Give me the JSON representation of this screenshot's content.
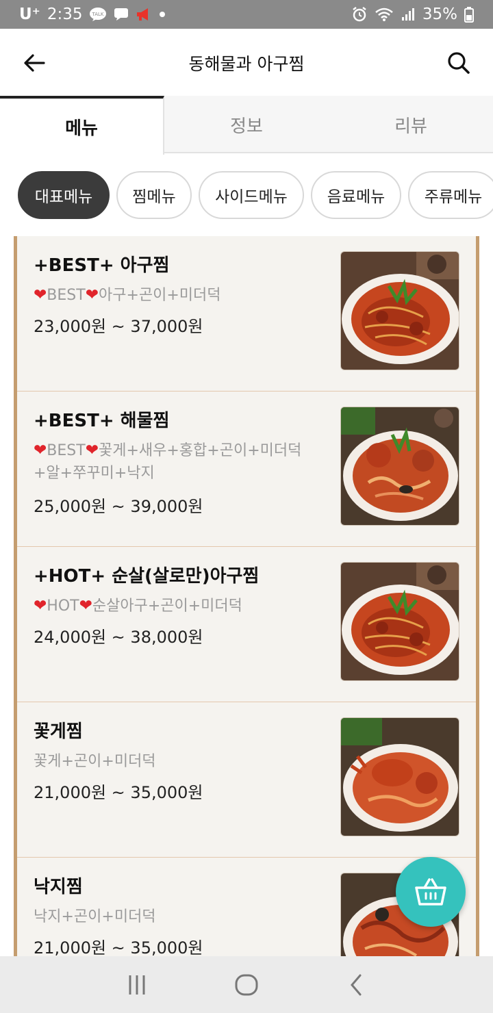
{
  "status_bar": {
    "carrier": "U⁺",
    "time": "2:35",
    "battery": "35%",
    "talk_badge": "TALK"
  },
  "header": {
    "title": "동해물과 아구찜"
  },
  "tabs": [
    {
      "label": "메뉴",
      "active": true
    },
    {
      "label": "정보",
      "active": false
    },
    {
      "label": "리뷰",
      "active": false
    }
  ],
  "categories": [
    {
      "label": "대표메뉴",
      "active": true
    },
    {
      "label": "찜메뉴",
      "active": false
    },
    {
      "label": "사이드메뉴",
      "active": false
    },
    {
      "label": "음료메뉴",
      "active": false
    },
    {
      "label": "주류메뉴",
      "active": false
    }
  ],
  "menu_items": [
    {
      "name": "+BEST+ 아구찜",
      "badge": "BEST",
      "desc": "아구+곤이+미더덕",
      "desc_line2": "",
      "price": "23,000원 ~ 37,000원"
    },
    {
      "name": "+BEST+ 해물찜",
      "badge": "BEST",
      "desc": "꽃게+새우+홍합+곤이+미더덕",
      "desc_line2": "+알+쭈꾸미+낙지",
      "price": "25,000원 ~ 39,000원"
    },
    {
      "name": "+HOT+ 순살(살로만)아구찜",
      "badge": "HOT",
      "desc": "순살아구+곤이+미더덕",
      "desc_line2": "",
      "price": "24,000원 ~ 38,000원"
    },
    {
      "name": "꽃게찜",
      "badge": "",
      "desc": "꽃게+곤이+미더덕",
      "desc_line2": "",
      "price": "21,000원 ~ 35,000원"
    },
    {
      "name": "낙지찜",
      "badge": "",
      "desc": "낙지+곤이+미더덕",
      "desc_line2": "",
      "price": "21,000원 ~ 35,000원"
    }
  ],
  "icons": {
    "back": "arrow-left-icon",
    "search": "search-icon",
    "cart": "basket-icon",
    "nav_recents": "recents-icon",
    "nav_home": "home-icon",
    "nav_back": "nav-back-icon"
  },
  "colors": {
    "accent": "#35c2bd",
    "chip_active": "#3b3b3b",
    "frame": "#c59d6f",
    "heart": "#e0242b"
  }
}
